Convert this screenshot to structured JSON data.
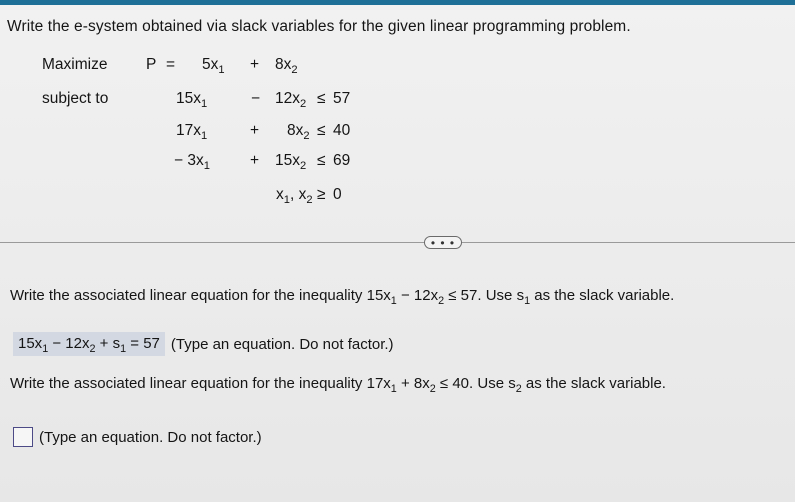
{
  "header": {
    "accent_color": "#1e6f97"
  },
  "instruction": "Write the e-system obtained via slack variables for the given linear programming problem.",
  "problem": {
    "maximize_label": "Maximize",
    "subject_to_label": "subject to",
    "objective": {
      "lhs": "P",
      "eq": "=",
      "t1_coef": "5",
      "op": "+",
      "t2_coef": "8"
    },
    "constraints": [
      {
        "t1_coef": "15",
        "op": "−",
        "t2_coef": "12",
        "rel": "≤",
        "rhs": "57"
      },
      {
        "t1_coef": "17",
        "op": "+",
        "t2_coef": "8",
        "rel": "≤",
        "rhs": "40"
      },
      {
        "t1_coef": "− 3",
        "op": "+",
        "t2_coef": "15",
        "rel": "≤",
        "rhs": "69"
      }
    ],
    "nonneg": {
      "vars": "x",
      "rel": "≥",
      "rhs": "0"
    },
    "var": "x",
    "sub1": "1",
    "sub2": "2"
  },
  "more_button": {
    "label": "• • •"
  },
  "questions": [
    {
      "prefix": "Write the associated linear equation for the inequality ",
      "ineq": {
        "c1": "15x",
        "s1": "1",
        "op": " − 12x",
        "s2": "2",
        "rest": " ≤ 57"
      },
      "mid": ". Use ",
      "slack": {
        "v": "s",
        "sub": "1"
      },
      "suffix": " as the slack variable.",
      "answer": {
        "c1": "15x",
        "s1": "1",
        "op": " − 12x",
        "s2": "2",
        "plus": " + s",
        "s3": "1",
        "rest": " = 57"
      },
      "hint": "(Type an equation. Do not factor.)"
    },
    {
      "prefix": "Write the associated linear equation for the inequality ",
      "ineq": {
        "c1": "17x",
        "s1": "1",
        "op": " + 8x",
        "s2": "2",
        "rest": " ≤ 40"
      },
      "mid": ". Use ",
      "slack": {
        "v": "s",
        "sub": "2"
      },
      "suffix": " as the slack variable.",
      "answer_value": "",
      "hint": "(Type an equation. Do not factor.)"
    }
  ]
}
